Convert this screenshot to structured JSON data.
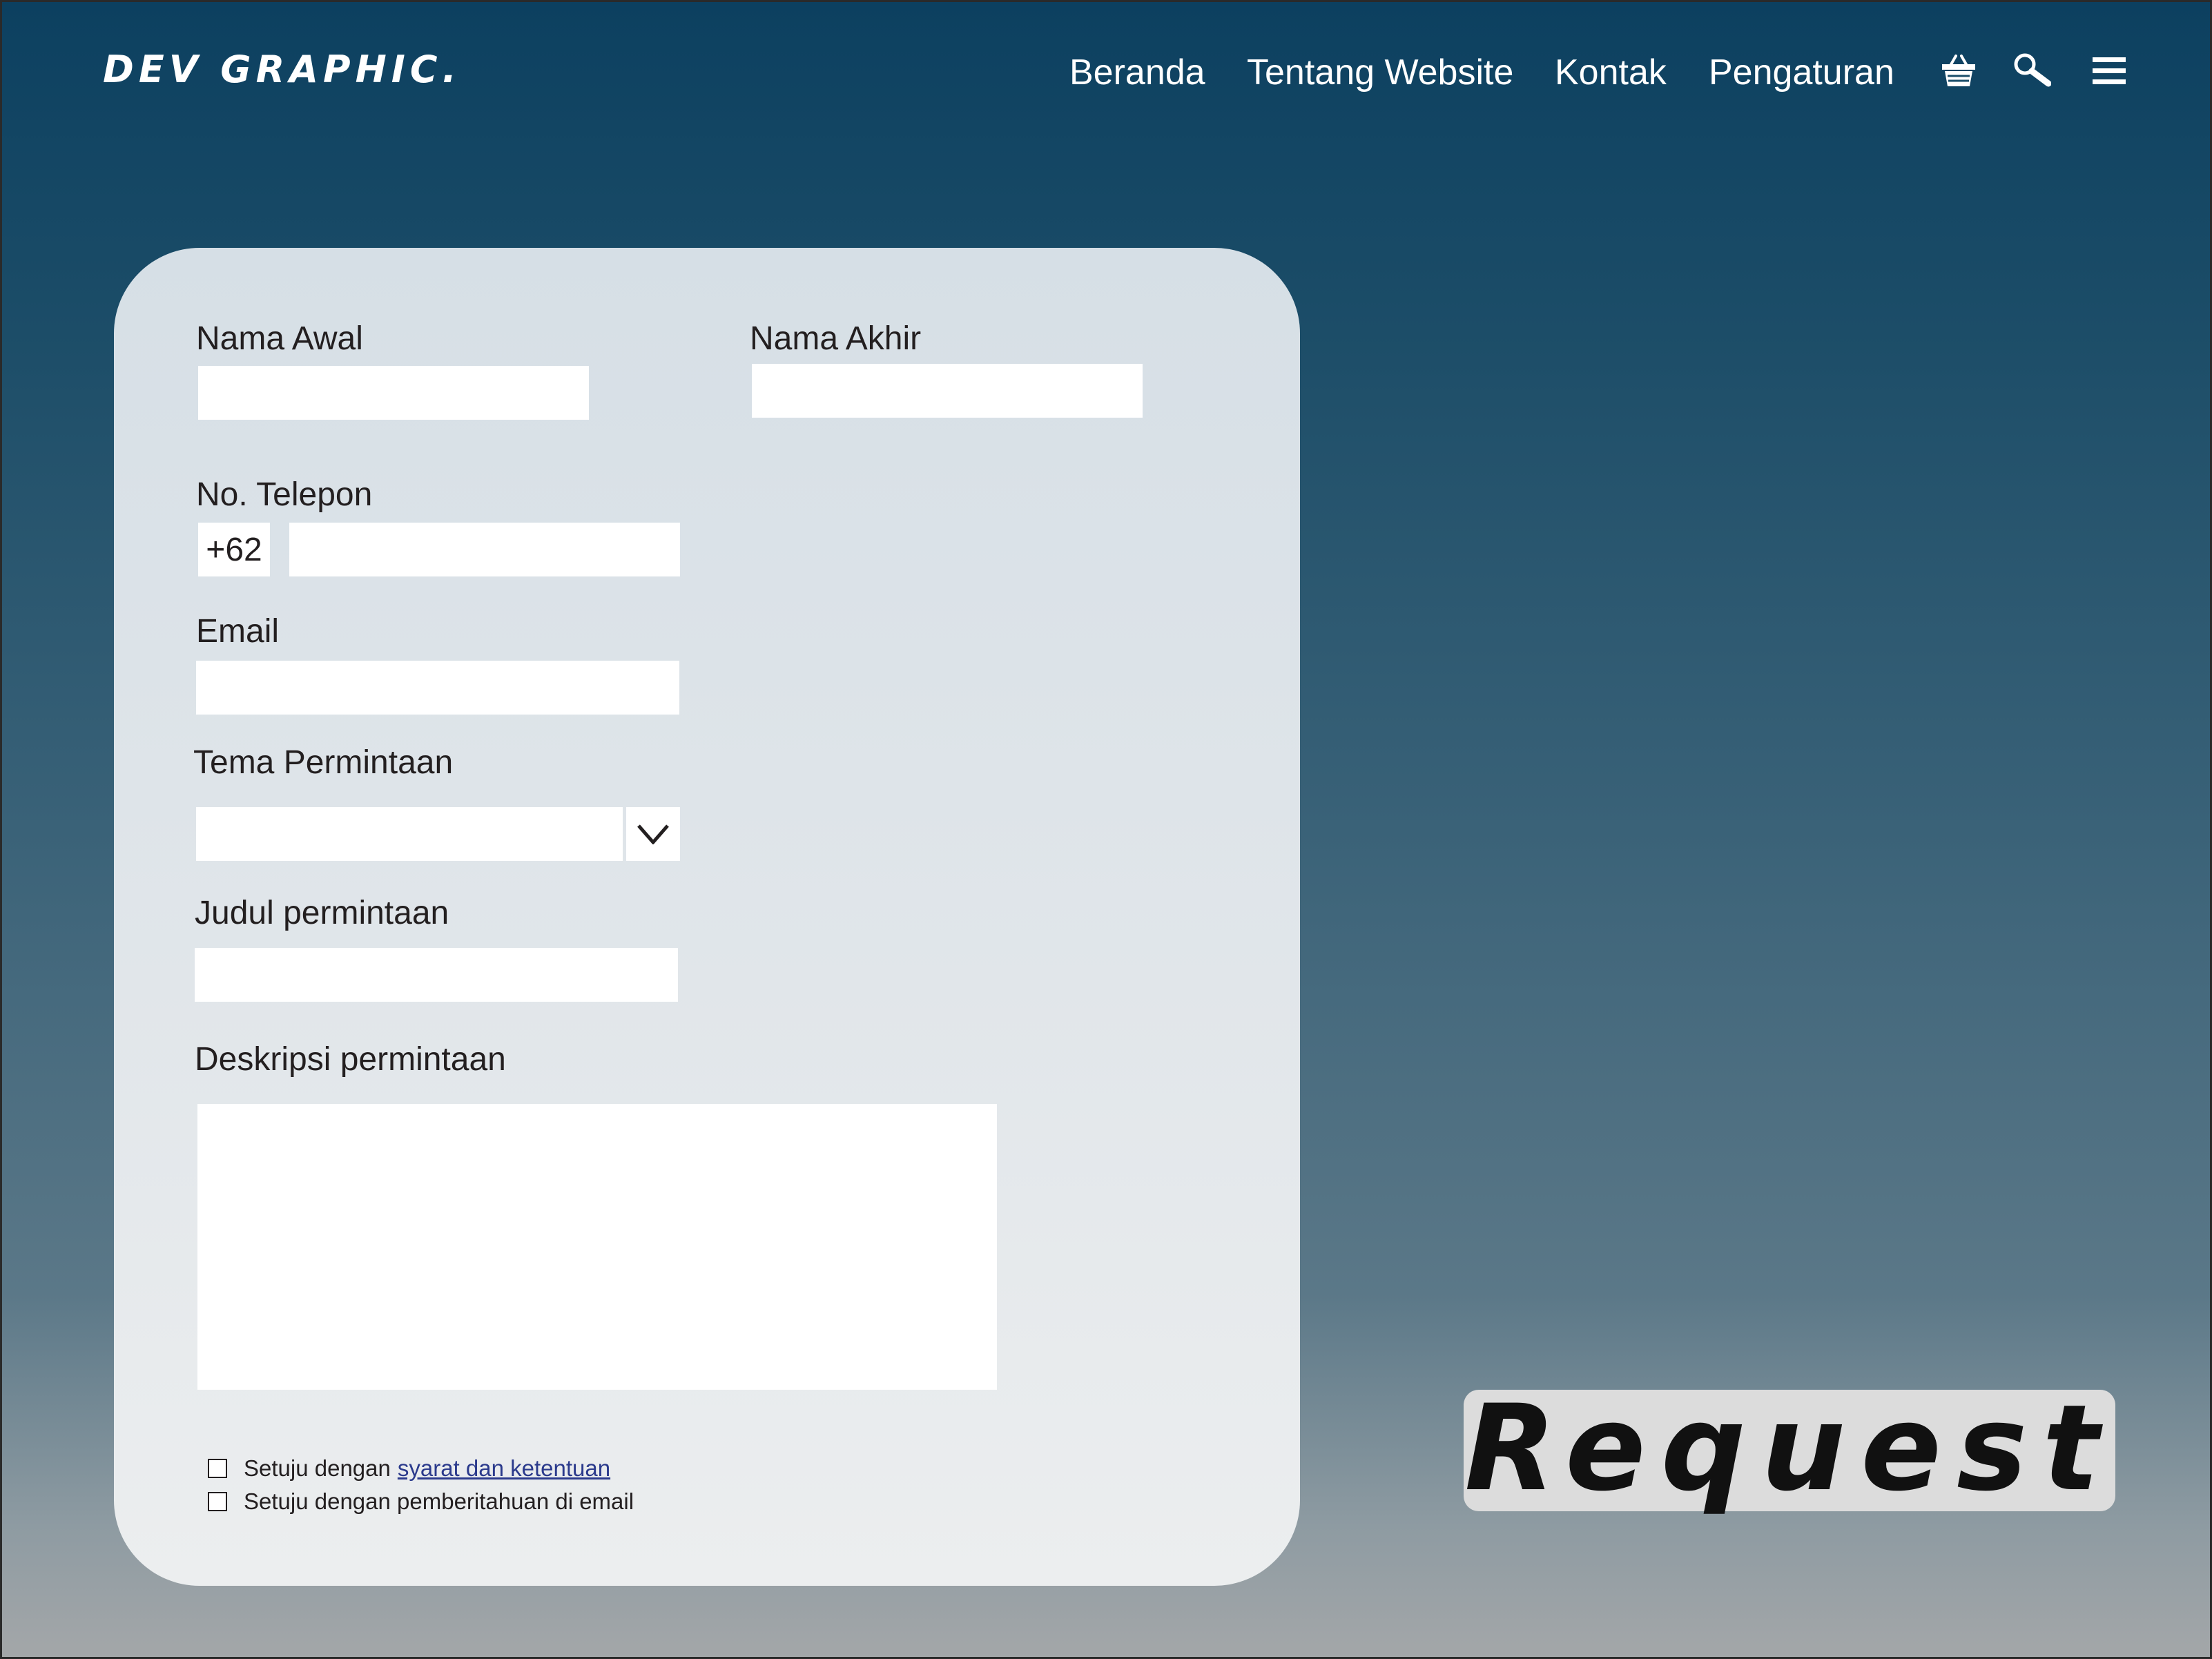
{
  "brand": {
    "logo": "DEV GRAPHIC."
  },
  "nav": {
    "items": [
      "Beranda",
      "Tentang Website",
      "Kontak",
      "Pengaturan"
    ],
    "icons": [
      "basket-icon",
      "search-icon",
      "menu-icon"
    ]
  },
  "form": {
    "first_name_label": "Nama Awal",
    "first_name_value": "",
    "last_name_label": "Nama Akhir",
    "last_name_value": "",
    "phone_label": "No. Telepon",
    "phone_prefix": "+62",
    "phone_value": "",
    "email_label": "Email",
    "email_value": "",
    "theme_label": "Tema Permintaan",
    "theme_value": "",
    "title_label": "Judul permintaan",
    "title_value": "",
    "description_label": "Deskripsi permintaan",
    "description_value": "",
    "agree_terms_prefix": "Setuju dengan",
    "agree_terms_link": "syarat dan ketentuan",
    "agree_terms_checked": false,
    "agree_email_label": "Setuju dengan pemberitahuan di email",
    "agree_email_checked": false
  },
  "request_button": {
    "label": "Request"
  },
  "colors": {
    "header_top": "#0c4060",
    "background_bottom": "#a4a7a9",
    "card": "#dfe5ea",
    "link": "#2b3a8c",
    "button": "#dcdcdc"
  }
}
